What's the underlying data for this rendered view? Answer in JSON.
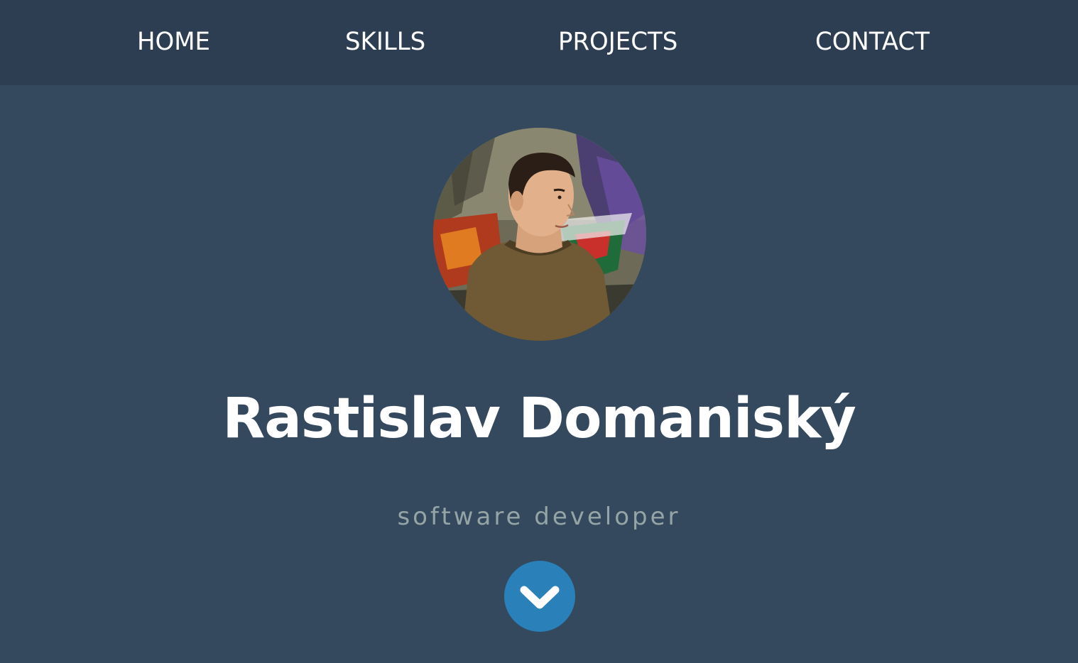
{
  "nav": {
    "items": [
      {
        "label": "HOME"
      },
      {
        "label": "SKILLS"
      },
      {
        "label": "PROJECTS"
      },
      {
        "label": "CONTACT"
      }
    ]
  },
  "hero": {
    "name": "Rastislav Domaniský",
    "subtitle": "software developer",
    "scroll_icon": "chevron-down-icon",
    "avatar_icon": "profile-photo"
  },
  "colors": {
    "nav_background": "#2e3e52",
    "page_background": "#34495e",
    "subtitle": "#95a5a6",
    "accent": "#2a80b9",
    "text": "#ffffff"
  }
}
